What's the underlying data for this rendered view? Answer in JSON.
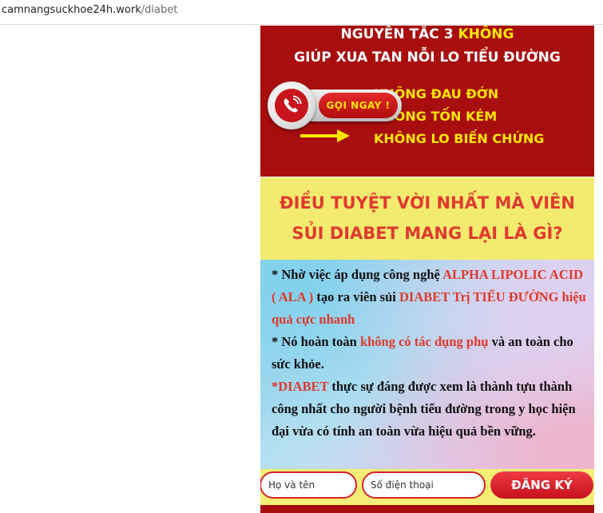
{
  "browser": {
    "url_domain": "camnangsuckhoe24h.work",
    "url_path": "/diabet"
  },
  "hero": {
    "line1_prefix": "NGUYÊN TẮC 3 ",
    "line1_keyword": "KHÔNG",
    "line2": "GIÚP XUA TAN NỖI LO TIỂU ĐƯỜNG",
    "benefits": [
      "KHÔNG ĐAU ĐỚN",
      "KHÔNG TỐN KÉM",
      "KHÔNG LO BIẾN CHỨNG"
    ],
    "call_button_label": "GỌI NGAY !"
  },
  "question": {
    "line1": "ĐIỀU TUYỆT VỜI NHẤT MÀ VIÊN",
    "line2": "SỦI DIABET MANG LẠI LÀ GÌ?"
  },
  "content": {
    "p1_a": "* Nhờ việc áp dụng công nghệ ",
    "p1_b": "ALPHA LIPOLIC ACID ( ALA )",
    "p1_c": " tạo ra viên sủi ",
    "p1_d": "DIABET Trị TIỂU ĐƯỜNG hiệu quả cực nhanh",
    "p2_a": "* Nó hoàn toàn ",
    "p2_b": "không có tác dụng phụ",
    "p2_c": " và an toàn cho sức khỏe.",
    "p3_a": "*DIABET",
    "p3_b": " thực sự đáng được xem là thành tựu thành công nhất cho người bệnh tiểu đường trong y học hiện đại vừa có tính an toàn vừa hiệu quả bền vững."
  },
  "form": {
    "name_placeholder": "Họ và tên",
    "phone_placeholder": "Số điện thoại",
    "submit_label": "ĐĂNG KÝ"
  },
  "colors": {
    "hero_red": "#a80e0e",
    "accent_yellow": "#ffe600",
    "headline_red": "#e03a2f",
    "question_bg": "#f2eb70"
  },
  "icons": [
    "phone-ringing-icon",
    "right-arrow-icon"
  ]
}
